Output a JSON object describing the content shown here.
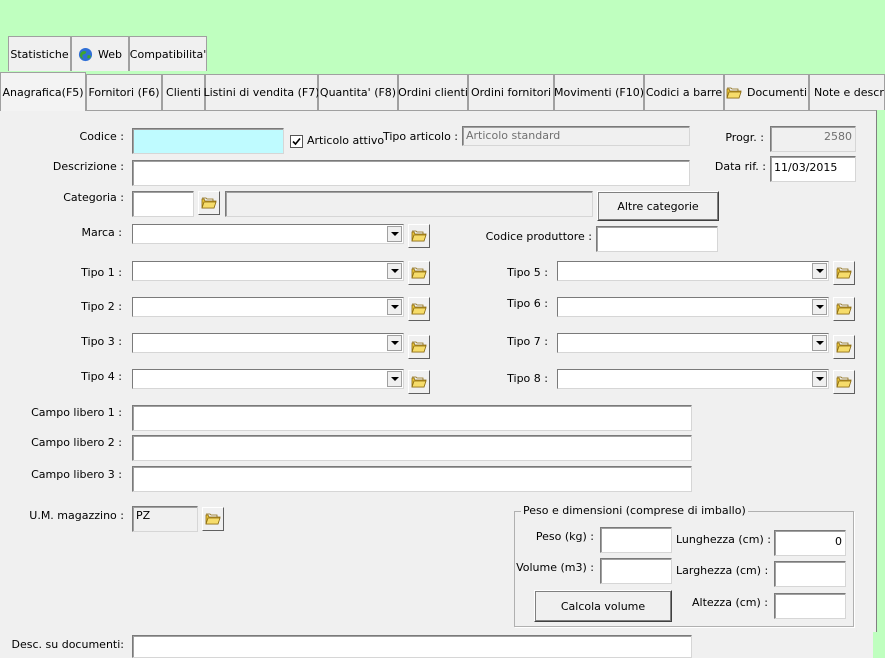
{
  "top_tabs": [
    {
      "label": "Statistiche"
    },
    {
      "label": "Web",
      "icon": "globe-icon"
    },
    {
      "label": "Compatibilita'"
    }
  ],
  "main_tabs": [
    {
      "label": "Anagrafica(F5)",
      "active": true
    },
    {
      "label": "Fornitori (F6)"
    },
    {
      "label": "Clienti"
    },
    {
      "label": "Listini di vendita (F7)"
    },
    {
      "label": "Quantita' (F8)"
    },
    {
      "label": "Ordini clienti"
    },
    {
      "label": "Ordini fornitori"
    },
    {
      "label": "Movimenti (F10)"
    },
    {
      "label": "Codici a barre"
    },
    {
      "label": "Documenti",
      "icon": "folder-icon"
    },
    {
      "label": "Note e descrizioni"
    }
  ],
  "form": {
    "codice_label": "Codice :",
    "codice_value": "",
    "articolo_attivo_label": "Articolo attivo",
    "articolo_attivo_checked": true,
    "tipo_articolo_label": "Tipo articolo :",
    "tipo_articolo_value": "Articolo standard",
    "progr_label": "Progr. :",
    "progr_value": "2580",
    "descrizione_label": "Descrizione :",
    "data_rif_label": "Data rif. :",
    "data_rif_value": "11/03/2015",
    "categoria_label": "Categoria :",
    "altre_categorie_label": "Altre categorie",
    "marca_label": "Marca :",
    "codice_produttore_label": "Codice produttore :",
    "tipi": [
      {
        "label": "Tipo 1 :"
      },
      {
        "label": "Tipo 2 :"
      },
      {
        "label": "Tipo 3 :"
      },
      {
        "label": "Tipo 4 :"
      },
      {
        "label": "Tipo 5 :"
      },
      {
        "label": "Tipo 6 :"
      },
      {
        "label": "Tipo 7 :"
      },
      {
        "label": "Tipo 8 :"
      }
    ],
    "campo_libero_1_label": "Campo libero 1 :",
    "campo_libero_2_label": "Campo libero 2 :",
    "campo_libero_3_label": "Campo libero 3 :",
    "um_label": "U.M. magazzino :",
    "um_value": "PZ",
    "desc_documenti_label": "Desc. su documenti:"
  },
  "peso": {
    "legend": "Peso e dimensioni (comprese di imballo)",
    "peso_label": "Peso (kg) :",
    "volume_label": "Volume (m3) :",
    "lunghezza_label": "Lunghezza (cm) :",
    "lunghezza_value": "0",
    "larghezza_label": "Larghezza (cm) :",
    "altezza_label": "Altezza (cm) :",
    "calcola_label": "Calcola volume"
  },
  "colors": {
    "background": "#bfffbf",
    "panel": "#f0f0f0",
    "codice_field": "#bffbff"
  }
}
